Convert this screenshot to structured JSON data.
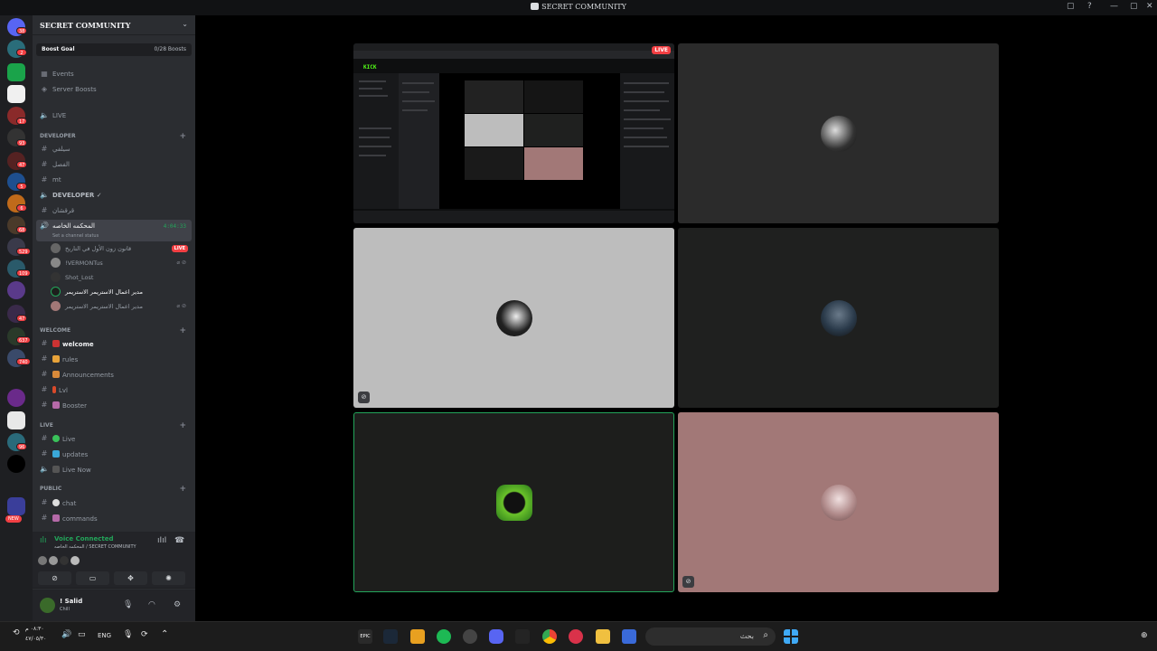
{
  "window": {
    "title": "SECRET COMMUNITY",
    "buttons": [
      "▢",
      "?",
      "—",
      "▢",
      "✕"
    ]
  },
  "rail": {
    "badges": [
      "38",
      "2",
      "17",
      "93",
      "47",
      "5",
      "6",
      "68",
      "529",
      "109",
      "47",
      "637",
      "740",
      "96"
    ],
    "new_label": "NEW"
  },
  "sidebar": {
    "guild_name": "SECRET COMMUNITY",
    "boost_goal": "Boost Goal",
    "boost_count": "0/28 Boosts",
    "events": "Events",
    "server_boosts": "Server Boosts",
    "live_channel": "LIVE",
    "developer_category": "DEVELOPER",
    "dev_channels": [
      "سيلفي",
      "الفصل",
      "mt",
      "DEVELOPER ✓",
      "قرقشان"
    ],
    "voice_channel": {
      "name": "المحكمه الخاصه",
      "timer": "4:04:33",
      "status": "Set a channel status"
    },
    "voice_users": [
      {
        "name": "قانون زون الأول في التاريخ",
        "live": "LIVE"
      },
      {
        "name": "!VERMONTus"
      },
      {
        "name": "Shot_Lost"
      },
      {
        "name": "مدير اعمال الاستريمر الاستريمر"
      },
      {
        "name": "مدير اعمال الاستريمر الاستريمر"
      }
    ],
    "welcome_category": "welcome",
    "welcome_channels": [
      "welcome",
      "rules",
      "Announcements",
      "Lvl",
      "Booster"
    ],
    "live_category": "LIVE",
    "live_channels": [
      "Live",
      "updates",
      "Live Now"
    ],
    "public_category": "PUBLIC",
    "public_channels": [
      "chat",
      "commands"
    ]
  },
  "voice_panel": {
    "status": "Voice Connected",
    "location": "المحكمه الخاصه / SECRET COMMUNITY"
  },
  "user_panel": {
    "username": "! Salid",
    "status": "Chill"
  },
  "stage": {
    "live_tag": "LIVE",
    "kick_logo": "KICK",
    "tiles": [
      {
        "kind": "screenshare",
        "bg": "#0e0f10"
      },
      {
        "kind": "camera-off",
        "bg": "#2b2b2b"
      },
      {
        "kind": "camera-off",
        "bg": "#bdbdbd",
        "muted": true
      },
      {
        "kind": "camera-off",
        "bg": "#1f201f"
      },
      {
        "kind": "camera-off",
        "bg": "#1d1e1c",
        "speaking": true
      },
      {
        "kind": "camera-off",
        "bg": "#a27877",
        "muted": true
      }
    ]
  },
  "taskbar": {
    "search_placeholder": "بحث",
    "language": "ENG",
    "time": "٠٨:٣٠ م",
    "date": "٤٧/٠٥/٣٠"
  },
  "colors": {
    "accent_green": "#23a55a",
    "live_red": "#f23f43",
    "kick_green": "#53fc18"
  }
}
